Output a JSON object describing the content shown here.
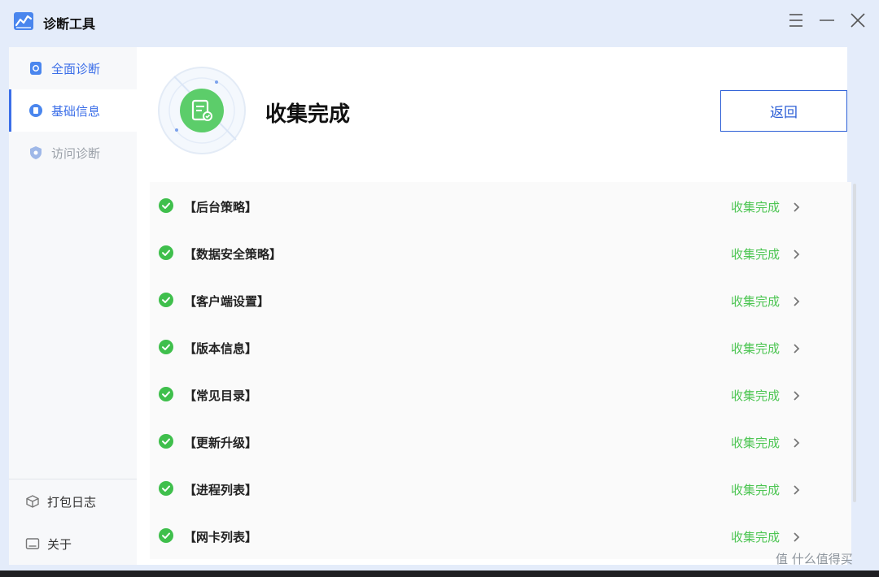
{
  "window": {
    "title": "诊断工具",
    "controls": [
      "menu-icon",
      "minimize-icon",
      "close-icon"
    ]
  },
  "sidebar": {
    "items": [
      {
        "label": "全面诊断",
        "icon": "full-diagnosis-icon",
        "state": "blue"
      },
      {
        "label": "基础信息",
        "icon": "basic-info-icon",
        "state": "active"
      },
      {
        "label": "访问诊断",
        "icon": "access-diagnosis-icon",
        "state": "disabled"
      }
    ],
    "footer": [
      {
        "label": "打包日志",
        "icon": "package-icon"
      },
      {
        "label": "关于",
        "icon": "about-icon"
      }
    ]
  },
  "main": {
    "title": "收集完成",
    "back_label": "返回",
    "rows": [
      {
        "name": "【后台策略】",
        "status": "收集完成"
      },
      {
        "name": "【数据安全策略】",
        "status": "收集完成"
      },
      {
        "name": "【客户端设置】",
        "status": "收集完成"
      },
      {
        "name": "【版本信息】",
        "status": "收集完成"
      },
      {
        "name": "【常见目录】",
        "status": "收集完成"
      },
      {
        "name": "【更新升级】",
        "status": "收集完成"
      },
      {
        "name": "【进程列表】",
        "status": "收集完成"
      },
      {
        "name": "【网卡列表】",
        "status": "收集完成"
      }
    ]
  },
  "watermark": "值 什么值得买",
  "colors": {
    "accent": "#3b6ee8",
    "success": "#4cc552",
    "titlebar_bg": "#e4ecfa",
    "sidebar_bg": "#f7f8fa"
  }
}
